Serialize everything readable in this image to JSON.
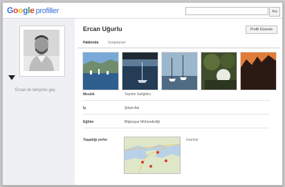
{
  "header": {
    "logo_g1": "G",
    "logo_g2": "o",
    "logo_g3": "o",
    "logo_g4": "g",
    "logo_g5": "l",
    "logo_g6": "e",
    "product": "profiller",
    "search_value": "",
    "search_button": "Ara"
  },
  "sidebar": {
    "contact_label": "Ercan ile iletişime geç"
  },
  "profile": {
    "name": "Ercan Uğurlu",
    "edit_button": "Profili Düzenle",
    "tabs": [
      "Hakkında",
      "Vurgulanan"
    ],
    "photos": [
      {
        "name": "photo-harbor"
      },
      {
        "name": "photo-sailboat"
      },
      {
        "name": "photo-marina"
      },
      {
        "name": "photo-tree"
      },
      {
        "name": "photo-sunset-palm"
      }
    ],
    "info": [
      {
        "label": "Meslek",
        "value": "Yazılım Geliştirici"
      },
      {
        "label": "İş",
        "value": "Şirket Adı"
      },
      {
        "label": "Eğitim",
        "value": "Bilgisayar Mühendisliği"
      }
    ],
    "map_label": "Yaşadığı yerler",
    "map_side_text": "İstanbul"
  }
}
